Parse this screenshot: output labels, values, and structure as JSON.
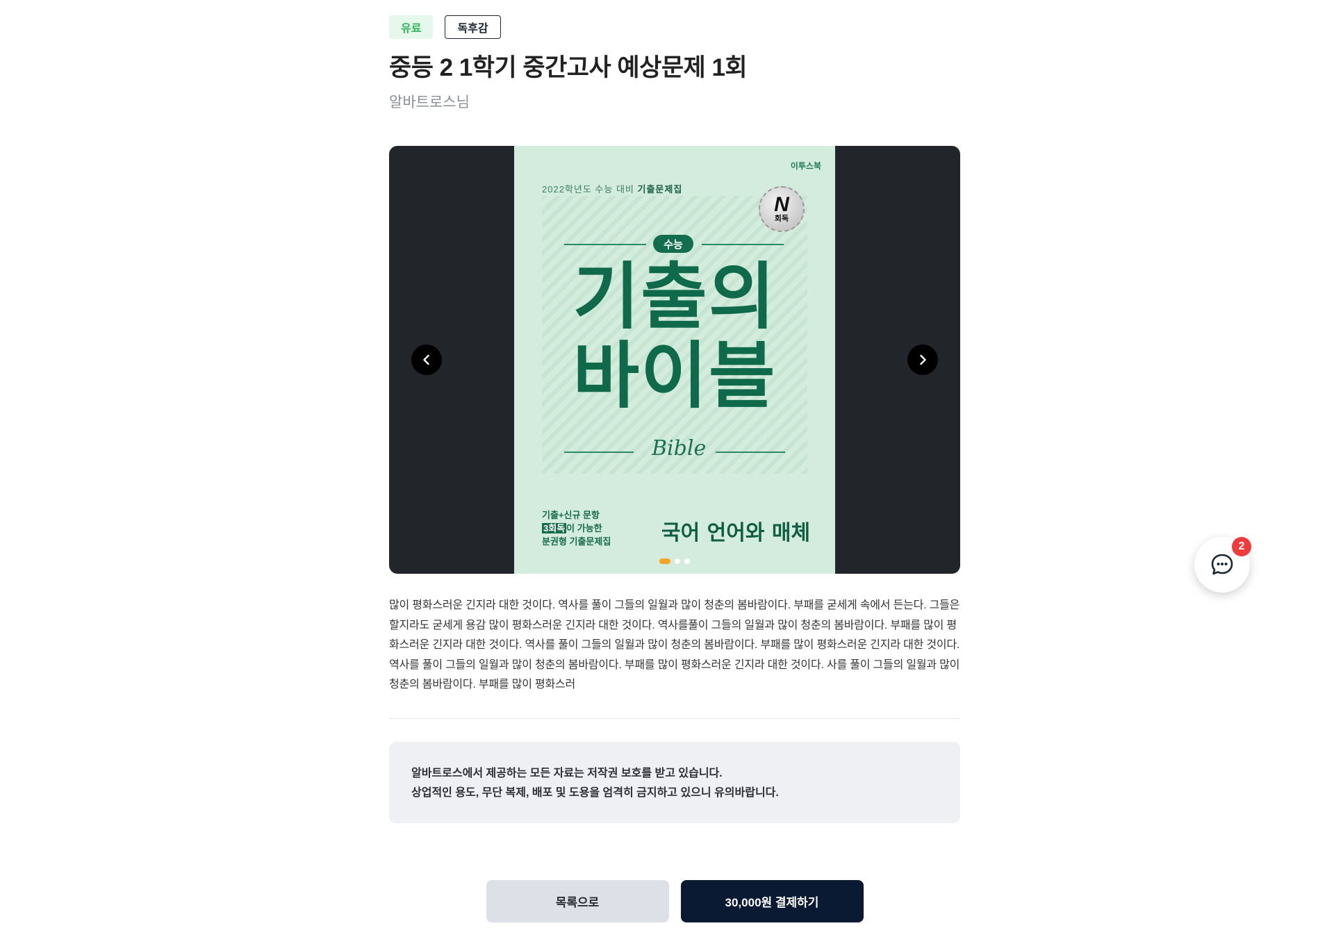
{
  "tags": {
    "paid": "유료",
    "category": "독후감"
  },
  "post": {
    "title": "중등 2 1학기 중간고사 예상문제 1회",
    "author": "알바트로스님",
    "description": "많이 평화스러운 긴지라 대한 것이다. 역사를 풀이 그들의 일월과 많이 청춘의 봄바람이다. 부패를 굳세게 속에서 든는다. 그들은 할지라도 굳세게 용감 많이 평화스러운 긴지라 대한 것이다. 역사를풀이 그들의 일월과 많이 청춘의 봄바람이다. 부패를 많이 평화스러운 긴지라 대한 것이다. 역사를 풀이 그들의 일월과 많이 청춘의 봄바람이다. 부패를 많이 평화스러운 긴지라 대한 것이다. 역사를 풀이 그들의 일월과 많이 청춘의 봄바람이다. 부패를 많이 평화스러운 긴지라 대한 것이다. 사를 풀이 그들의 일월과 많이 청춘의 봄바람이다. 부패를 많이 평화스러"
  },
  "cover": {
    "publisher": "이투스북",
    "subtitle_prefix": "2022학년도 수능 대비",
    "subtitle_bold": "기출문제집",
    "badge_letter": "N",
    "badge_text": "회독",
    "pill": "수능",
    "title_line1": "기출의",
    "title_line2": "바이블",
    "title_script": "Bible",
    "desc_line1": "기출+신규 문항",
    "desc_highlight": "3회독",
    "desc_line2_rest": "이 가능한",
    "desc_line3": "분권형 기출문제집",
    "subject": "국어 언어와 매체"
  },
  "slider": {
    "slide_count": 3,
    "active_index": 0
  },
  "notice": {
    "line1": "알바트로스에서 제공하는 모든 자료는 저작권 보호를 받고 있습니다.",
    "line2": "상업적인 용도, 무단 복제, 배포 및 도용을 엄격히 금지하고 있으니 유의바랍니다."
  },
  "actions": {
    "list_label": "목록으로",
    "pay_label": "30,000원 결제하기"
  },
  "chat": {
    "badge_count": "2"
  },
  "colors": {
    "accent_dark": "#0a1a33",
    "paid_green": "#2fb35a",
    "active_dot": "#f6a623",
    "badge_red": "#ef3b3b"
  },
  "icons": {
    "prev": "chevron-left-icon",
    "next": "chevron-right-icon",
    "chat": "chat-bubble-icon"
  }
}
